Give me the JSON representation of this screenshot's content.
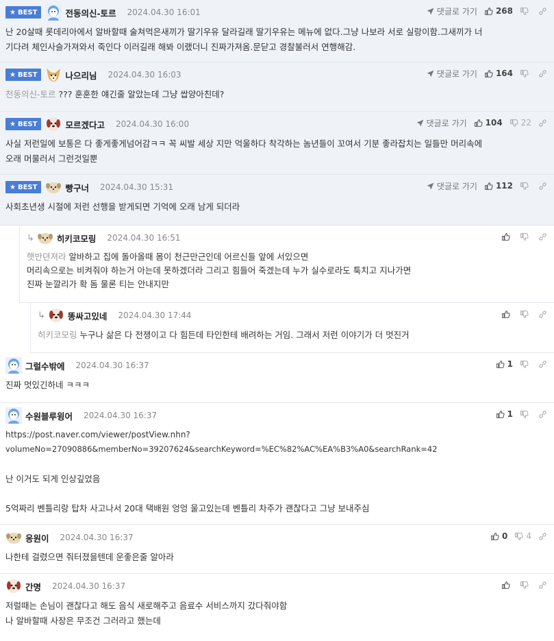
{
  "colors": {
    "best_bg": "#eff3f8",
    "badge": "#4a7dd6"
  },
  "labels": {
    "best": "BEST",
    "goto": "댓글로 가기"
  },
  "comments": [
    {
      "nick": "전동의신-토르",
      "date": "2024.04.30 16:01",
      "up": "268",
      "down": "",
      "lines": [
        "난 20살때 롯데리아에서 알바할때 술쳐먹은새끼가 딸기우유 달라길래 딸기우유는 메뉴에 없다.그냥 나보라 서로 실랑이함.그새끼가 너",
        "기다려 체인사슬가져와서 죽인다 이러길래 해봐 이랬더니 진짜가져옴.문닫고 경찰불러서 연행해감."
      ]
    },
    {
      "nick": "나으리님",
      "date": "2024.04.30 16:03",
      "up": "164",
      "down": "",
      "mention": "천동의신-토르",
      "lines": [
        "??? 훈훈한 얘긴줄 알았는데 그냥 쌉양아친데?"
      ]
    },
    {
      "nick": "모르겠다고",
      "date": "2024.04.30 16:00",
      "up": "104",
      "down": "22",
      "lines": [
        "사실 저런일에 보통은 다 좋게좋게넘어감ㅋㅋ 꼭 씨발 세상 지만 억울하다 착각하는 놈년들이 꼬여서 기분 좋라잡치는 일들만 머리속에",
        "오래 머물러서 그런것일뿐"
      ]
    },
    {
      "nick": "빵구너",
      "date": "2024.04.30 15:31",
      "up": "112",
      "down": "",
      "lines": [
        "사회초년생 시절에 저런 선행을 받게되면 기억에 오래 남게 되더라"
      ]
    },
    {
      "nick": "히키코모링",
      "date": "2024.04.30 16:51",
      "up": "",
      "down": "",
      "mention": "햇반뎐져라",
      "lines": [
        "알바하고 집에 돌아올때 몸이 천근만근인데 어르신들 앞에 서있으면",
        "머리속으로는 비켜줘야 하는거 아는데 못하겠더라 그리고 힘들어 죽겠는데 누가 실수로라도 툭치고 지나가면",
        "진짜 눈깔리가 확 돔 물론 티는 안내지만"
      ]
    },
    {
      "nick": "똥싸고있네",
      "date": "2024.04.30 17:44",
      "up": "",
      "down": "",
      "mention": "히키코모링",
      "lines": [
        "누구나 삶은 다 전쟁이고 다 힘든데 타인한테 배려하는 거임. 그래서 저런 이야기가 더 멋진거"
      ]
    },
    {
      "nick": "그럴수밖에",
      "date": "2024.04.30 16:37",
      "up": "1",
      "down": "",
      "lines": [
        "진짜 멋있긴하네 ㅋㅋㅋ"
      ]
    },
    {
      "nick": "수원블루윙어",
      "date": "2024.04.30 16:37",
      "up": "1",
      "down": "",
      "lines": [
        "https://post.naver.com/viewer/postView.nhn?",
        "volumeNo=27090886&memberNo=39207624&searchKeyword=%EC%82%AC%EA%B3%A0&searchRank=42",
        "",
        "난 이거도 되게 인상깊었음",
        "",
        "5억짜리 벤틀리랑 탑차 사고나서 20대 택배원 엉엉 울고있는데 벤틀리 차주가 괜찮다고 그냥 보내주심"
      ]
    },
    {
      "nick": "응원이",
      "date": "2024.04.30 16:37",
      "up": "0",
      "down": "4",
      "lines": [
        "나한테 걸렸으면 줘터졌을텐데 운좋은줄 알아라"
      ]
    },
    {
      "nick": "간명",
      "date": "2024.04.30 16:37",
      "up": "",
      "down": "",
      "lines": [
        "저럴때는 손님이 괜찮다고 해도 음식 새로해주고 음료수 서비스까지 갔다줘야함",
        "나 알바할때 사장은 무조건 그러라고 했는데"
      ]
    }
  ]
}
